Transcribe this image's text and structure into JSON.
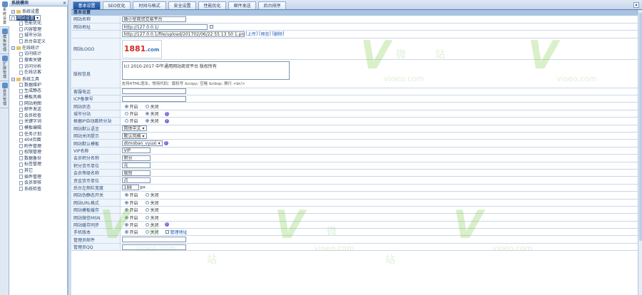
{
  "vtabs": [
    {
      "label": "系统设置"
    },
    {
      "label": "模板管理"
    },
    {
      "label": "扩展管理"
    },
    {
      "label": "会员管理"
    }
  ],
  "tree": {
    "title": "系统模块",
    "close": "×",
    "groups": [
      {
        "label": "系统设置",
        "items": [
          "网站设置",
          "性能优化",
          "内容管理",
          "城市分站",
          "后台自定义"
        ],
        "selected": 0
      },
      {
        "label": "在线统计",
        "items": [
          "访问统计",
          "搜索关键",
          "访问分析",
          "在线访客"
        ]
      },
      {
        "label": "系统工具",
        "items": [
          "数据维护",
          "生成静态",
          "模板风格",
          "网站地图",
          "邮件发送",
          "会员检查",
          "关键字词",
          "模板编辑",
          "任务计划",
          "404页面",
          "附件管理",
          "权限管理",
          "数据备份",
          "标签管理",
          "其它",
          "插件管理",
          "会员审核",
          "系统检查"
        ]
      }
    ]
  },
  "top_tabs": [
    "基本设置",
    "SEO优化",
    "时间与格式",
    "安全设置",
    "性能优化",
    "邮件发送",
    "后台排序"
  ],
  "panel_title": "基本设置",
  "form": {
    "site_name_label": "网站名称",
    "site_name_value": "微小型商贸交易平台",
    "site_url_label": "网站地址",
    "site_url_value": "http://127.0.0.1/",
    "logo_path_value": "http://127.0.0.1/file/upload/201702/06/22 55 13 50 1.png",
    "upload_label": "上传",
    "preview_label": "预览",
    "delete_label": "删除",
    "logo_label": "网站LOGO",
    "logo_text": "1881",
    "logo_suffix": ".com",
    "copyright_label": "版权信息",
    "copyright_value": "(c) 2010-2017 中午通用网站商贸平台 版权所有",
    "copyright_hint": "支持HTML语法，常用代码：版权号 &copy; 空格 &nbsp; 换行 <br/>",
    "rows": [
      {
        "label": "客服电话",
        "type": "input",
        "value": "",
        "w": 90
      },
      {
        "label": "ICP备案号",
        "type": "input",
        "value": "",
        "w": 90
      },
      {
        "label": "网站状态",
        "type": "radio",
        "options": [
          "开启",
          "关闭"
        ],
        "on": 0
      },
      {
        "label": "城市分站",
        "type": "radio",
        "options": [
          "开启",
          "关闭"
        ],
        "on": 1,
        "help": true
      },
      {
        "label": "根据IP自动跳转分站",
        "type": "radio",
        "options": [
          "开启",
          "关闭"
        ],
        "on": 1,
        "help": true
      },
      {
        "label": "网站默认语言",
        "type": "select",
        "value": "简体中文"
      },
      {
        "label": "网站关闭提示",
        "type": "select",
        "value": "默认风格"
      },
      {
        "label": "网站默认模板",
        "type": "select",
        "value": "dtmoban_vyuxi",
        "help": true
      },
      {
        "label": "VIP名称",
        "type": "input",
        "value": "VIP",
        "w": 40
      },
      {
        "label": "会员积分名称",
        "type": "input",
        "value": "积分",
        "w": 40
      },
      {
        "label": "积分货币单位",
        "type": "input",
        "value": "元",
        "w": 40
      },
      {
        "label": "会员等级名称",
        "type": "input",
        "value": "级别",
        "w": 40
      },
      {
        "label": "资金货币单位",
        "type": "input",
        "value": "点",
        "w": 40
      },
      {
        "label": "后台左侧栏宽度",
        "type": "input",
        "value": "188",
        "w": 24,
        "unit": "px"
      },
      {
        "label": "网站伪静态开关",
        "type": "radio",
        "options": [
          "开启",
          "关闭"
        ],
        "on": 0
      },
      {
        "label": "网站URL格式",
        "type": "radio",
        "options": [
          "开启",
          "关闭"
        ],
        "on": 0
      },
      {
        "label": "网站模板缓存",
        "type": "radio",
        "options": [
          "开启",
          "关闭"
        ],
        "on": 0
      },
      {
        "label": "网站微信MSN",
        "type": "radio",
        "options": [
          "开启",
          "关闭"
        ],
        "on": 0
      },
      {
        "label": "网站缓存同步",
        "type": "radio",
        "options": [
          "开启",
          "关闭"
        ],
        "on": 0,
        "help": true
      },
      {
        "label": "手机版本",
        "type": "radio",
        "options": [
          "开启",
          "关闭"
        ],
        "on": 0,
        "extra": "管理地址"
      },
      {
        "label": "管理员邮件",
        "type": "input",
        "value": "",
        "w": 90
      },
      {
        "label": "管理员QQ",
        "type": "input",
        "value": "",
        "w": 90
      }
    ]
  },
  "watermark": {
    "mark": "V",
    "text": "vioeo.com",
    "char1": "微",
    "char2": "站"
  },
  "colors": {
    "accent": "#1e4f97",
    "panel_head": "#a9c3e2",
    "watermark": "#78c83c"
  }
}
